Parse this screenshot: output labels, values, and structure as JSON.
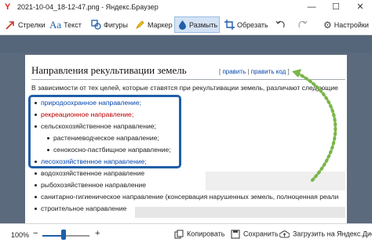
{
  "window": {
    "app_icon": "Y",
    "title": "2021-10-04_18-12-47.png - Яндекс.Браузер",
    "minimize": "—",
    "maximize": "☐",
    "close": "✕"
  },
  "toolbar": {
    "arrows": "Стрелки",
    "text": "Текст",
    "shapes": "Фигуры",
    "marker": "Маркер",
    "blur": "Размыть",
    "crop": "Обрезать",
    "settings": "Настройки"
  },
  "doc": {
    "heading": "Направления рекультивации земель",
    "edit_open": "[ ",
    "edit": "править",
    "edit_sep": " | ",
    "edit_code": "править код",
    "edit_close": " ]",
    "intro": "В зависимости от тех целей, которые ставятся при рекультивации земель, различают следующие",
    "items": [
      "природоохранное направление;",
      "рекреационное направление;",
      "сельскохозяйственное направление;",
      "растениеводческое направление;",
      "сенокосно-пастбищное направление;",
      "лесохозяйственное направление;",
      "водохозяйственное направление",
      "рыбохозяйственное направление",
      "санитарно-гигиеническое направление (консервация нарушенных земель, полноценная реали",
      "строительное направление"
    ]
  },
  "bottom": {
    "zoom": "100%",
    "copy": "Копировать",
    "save": "Сохранить",
    "upload": "Загрузить на Яндекс.Диск",
    "zoom_level": 0.45
  },
  "colors": {
    "accent": "#1f5fa8",
    "link": "#0645ad",
    "red_link": "#ba0000",
    "arrow": "#7ab648"
  }
}
